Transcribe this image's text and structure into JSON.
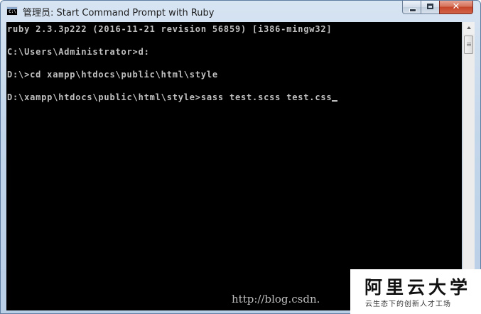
{
  "window": {
    "title": "管理员: Start Command Prompt with Ruby",
    "icon": "console-app-icon",
    "icon_text": "C:\\.",
    "close_symbol": "✕"
  },
  "console": {
    "lines": [
      "ruby 2.3.3p222 (2016-11-21 revision 56859) [i386-mingw32]",
      "",
      "C:\\Users\\Administrator>d:",
      "",
      "D:\\>cd xampp\\htdocs\\public\\html\\style",
      "",
      "D:\\xampp\\htdocs\\public\\html\\style>sass test.scss test.css"
    ],
    "text_color": "#c0c0c0",
    "background_color": "#000000"
  },
  "watermark": {
    "url_text": "http://blog.csdn.",
    "logo_main": "阿里云大学",
    "logo_sub": "云生态下的创新人才工场"
  }
}
